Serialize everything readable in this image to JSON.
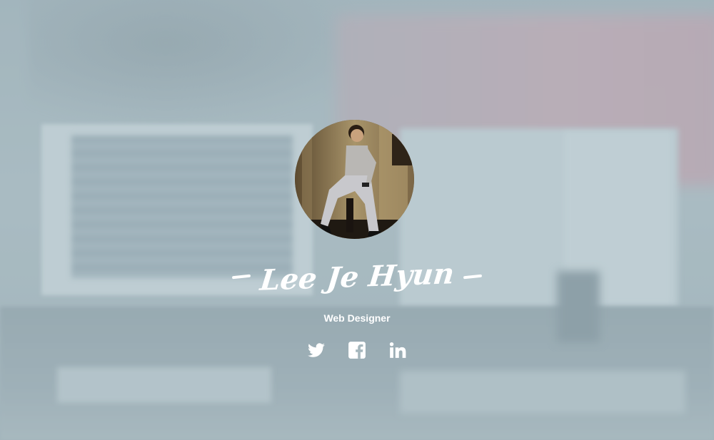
{
  "profile": {
    "name": "Lee Je Hyun",
    "role": "Web Designer"
  },
  "social": [
    {
      "icon": "twitter-icon"
    },
    {
      "icon": "facebook-icon"
    },
    {
      "icon": "linkedin-icon"
    }
  ],
  "colors": {
    "text": "#ffffff",
    "background_tint": "#a6b7bd"
  }
}
